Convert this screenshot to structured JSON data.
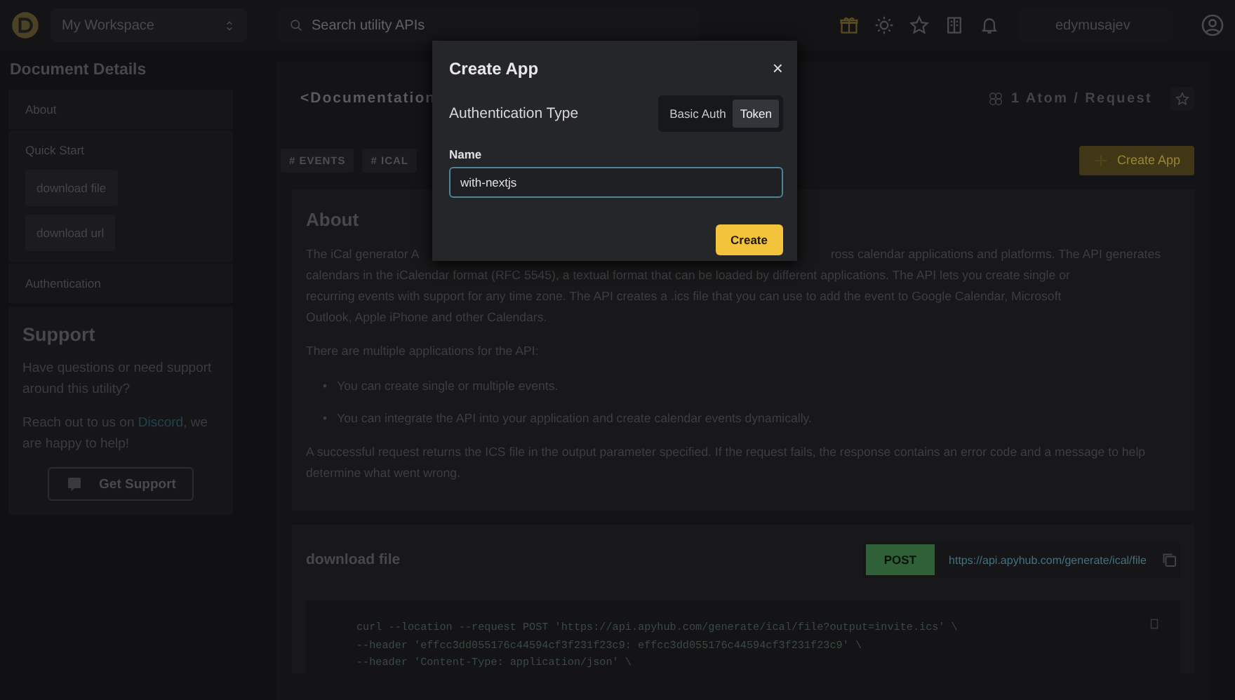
{
  "topbar": {
    "workspace": "My Workspace",
    "search_placeholder": "Search utility APIs",
    "username": "edymusajev"
  },
  "sidebar": {
    "title": "Document Details",
    "items": [
      {
        "label": "About"
      },
      {
        "label": "Quick Start",
        "children": [
          {
            "label": "download file"
          },
          {
            "label": "download url"
          }
        ]
      },
      {
        "label": "Authentication"
      }
    ],
    "support": {
      "title": "Support",
      "text": "Have questions or need support around this utility?",
      "contact_before": "Reach out to us on ",
      "link": "Discord",
      "contact_after": ", we are happy to help!",
      "button": "Get Support"
    }
  },
  "main": {
    "title": "<Documentation",
    "atoms": "1 Atom / Request",
    "tags": [
      "# EVENTS",
      "# ICAL"
    ],
    "create_app": "Create App",
    "about": {
      "heading": "About",
      "first_line_start": "The iCal generator A",
      "first_line_end": "ross calendar applications and platforms. The API generates",
      "lines": [
        "calendars in the iCalendar format (RFC 5545), a textual format that can be loaded by different applications. The API lets you create single or",
        "recurring events with support for any time zone. The API creates a .ics file that you can use to add the event to Google Calendar, Microsoft",
        "Outlook, Apple iPhone and other Calendars."
      ],
      "intro": "There are multiple applications for the API:",
      "bullets": [
        {
          "marker": "•",
          "text": "You can create single or multiple events."
        },
        {
          "marker": "•",
          "text": "You can integrate the API into your application and create calendar events dynamically."
        }
      ],
      "outro": "A successful request returns the ICS file in the output parameter specified. If the request fails, the response contains an error code and a message to help determine what went wrong."
    },
    "endpoint": {
      "title": "download file",
      "method": "POST",
      "url": "https://api.apyhub.com/generate/ical/file",
      "code": [
        "curl --location --request POST 'https://api.apyhub.com/generate/ical/file?output=invite.ics' \\",
        "--header 'effcc3dd055176c44594cf3f231f23c9: effcc3dd055176c44594cf3f231f23c9' \\",
        "--header 'Content-Type: application/json' \\"
      ]
    }
  },
  "modal": {
    "title": "Create App",
    "close": "×",
    "auth_label": "Authentication Type",
    "auth_options": [
      {
        "label": "Basic Auth",
        "selected": false
      },
      {
        "label": "Token",
        "selected": true
      }
    ],
    "name_label": "Name",
    "name_value": "with-nextjs",
    "submit": "Create"
  }
}
